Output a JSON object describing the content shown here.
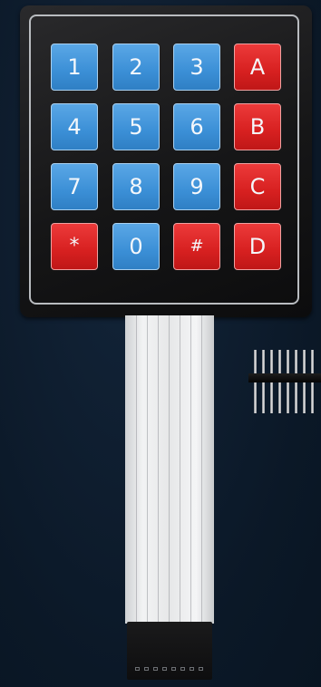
{
  "keypad": {
    "rows": [
      [
        {
          "label": "1",
          "color": "blue"
        },
        {
          "label": "2",
          "color": "blue"
        },
        {
          "label": "3",
          "color": "blue"
        },
        {
          "label": "A",
          "color": "red"
        }
      ],
      [
        {
          "label": "4",
          "color": "blue"
        },
        {
          "label": "5",
          "color": "blue"
        },
        {
          "label": "6",
          "color": "blue"
        },
        {
          "label": "B",
          "color": "red"
        }
      ],
      [
        {
          "label": "7",
          "color": "blue"
        },
        {
          "label": "8",
          "color": "blue"
        },
        {
          "label": "9",
          "color": "blue"
        },
        {
          "label": "C",
          "color": "red"
        }
      ],
      [
        {
          "label": "*",
          "color": "red"
        },
        {
          "label": "0",
          "color": "blue"
        },
        {
          "label": "#",
          "color": "red"
        },
        {
          "label": "D",
          "color": "red"
        }
      ]
    ],
    "colors": {
      "blue_key": "#3b8fd6",
      "red_key": "#d72020",
      "body": "#161617",
      "frame": "#b9bcc0",
      "background": "#0d1a29"
    }
  }
}
